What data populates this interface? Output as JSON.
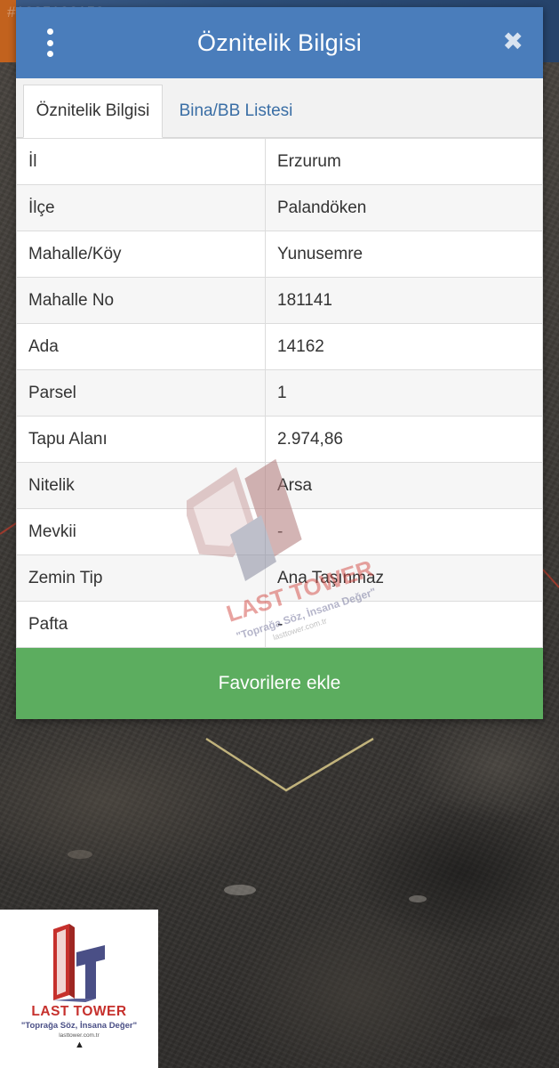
{
  "background": {
    "watermark_id": "#1285106150"
  },
  "modal": {
    "title": "Öznitelik Bilgisi",
    "menu_icon": "kebab-menu-icon",
    "close_icon": "close-icon",
    "close_glyph": "✖",
    "header_color": "#4a7dbb",
    "tabs": [
      {
        "label": "Öznitelik Bilgisi",
        "active": true
      },
      {
        "label": "Bina/BB Listesi",
        "active": false
      }
    ],
    "rows": [
      {
        "key": "İl",
        "value": "Erzurum"
      },
      {
        "key": "İlçe",
        "value": "Palandöken"
      },
      {
        "key": "Mahalle/Köy",
        "value": "Yunusemre"
      },
      {
        "key": "Mahalle No",
        "value": "181141"
      },
      {
        "key": "Ada",
        "value": "14162"
      },
      {
        "key": "Parsel",
        "value": "1"
      },
      {
        "key": "Tapu Alanı",
        "value": "2.974,86"
      },
      {
        "key": "Nitelik",
        "value": "Arsa"
      },
      {
        "key": "Mevkii",
        "value": "-"
      },
      {
        "key": "Zemin Tip",
        "value": "Ana Taşınmaz"
      },
      {
        "key": "Pafta",
        "value": "-"
      }
    ],
    "favorites_button": "Favorilere ekle",
    "favorites_color": "#5cad5f"
  },
  "watermark": {
    "brand": "LAST TOWER",
    "slogan": "\"Toprağa Söz, İnsana Değer\"",
    "url": "lasttower.com.tr"
  },
  "brand_card": {
    "name": "LAST TOWER",
    "slogan": "\"Toprağa Söz, İnsana Değer\"",
    "url": "lasttower.com.tr",
    "accent_red": "#c6302c",
    "accent_navy": "#4a4f86"
  }
}
